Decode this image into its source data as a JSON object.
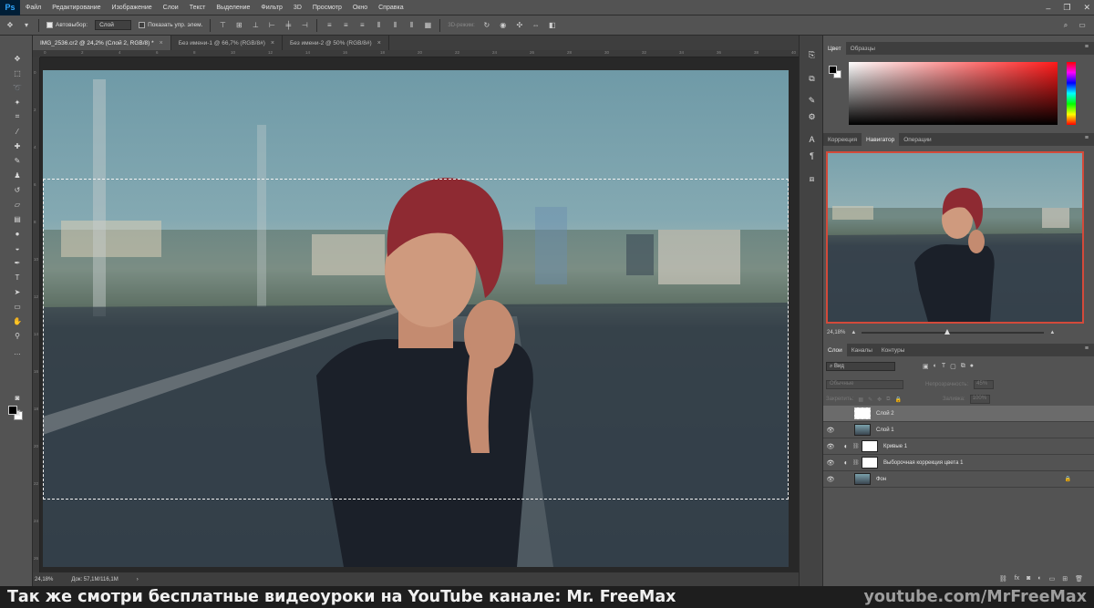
{
  "app": {
    "logo": "Ps"
  },
  "menu": [
    "Файл",
    "Редактирование",
    "Изображение",
    "Слои",
    "Текст",
    "Выделение",
    "Фильтр",
    "3D",
    "Просмотр",
    "Окно",
    "Справка"
  ],
  "options_bar": {
    "autoselect_label": "Автовыбор:",
    "autoselect_value": "Слой",
    "show_transform_label": "Показать упр. элем.",
    "mode_3d_label": "3D-режим:"
  },
  "document_tabs": [
    {
      "label": "IMG_2536.cr2 @ 24,2% (Слой 2, RGB/8) *",
      "active": true
    },
    {
      "label": "Без имени-1 @ 66,7% (RGB/8#)",
      "active": false
    },
    {
      "label": "Без имени-2 @ 50% (RGB/8#)",
      "active": false
    }
  ],
  "ruler_top_ticks": [
    "0",
    "2",
    "4",
    "6",
    "8",
    "10",
    "12",
    "14",
    "16",
    "18",
    "20",
    "22",
    "24",
    "26",
    "28",
    "30",
    "32",
    "34",
    "36",
    "38",
    "40"
  ],
  "ruler_left_ticks": [
    "0",
    "2",
    "4",
    "6",
    "8",
    "10",
    "12",
    "14",
    "16",
    "18",
    "20",
    "22",
    "24",
    "26"
  ],
  "status_bar": {
    "zoom": "24,18%",
    "doc_size": "Док: 57,1М/116,1М"
  },
  "color_panel": {
    "tabs": [
      "Цвет",
      "Образцы"
    ],
    "foreground_color": "#000000",
    "background_color": "#ffffff"
  },
  "navigator_panel": {
    "tabs": [
      "Коррекция",
      "Навигатор",
      "Операции"
    ],
    "active_tab": "Навигатор",
    "zoom": "24,18%",
    "zoom_slider_fraction": 0.47,
    "view_box_color": "#d34a3a"
  },
  "layers_panel": {
    "tabs": [
      "Слои",
      "Каналы",
      "Контуры"
    ],
    "kind_filter": "Вид",
    "blend_mode": "Обычные",
    "opacity_label": "Непрозрачность:",
    "opacity_value": "45%",
    "lock_label": "Закрепить:",
    "fill_label": "Заливка:",
    "fill_value": "100%",
    "layers": [
      {
        "name": "Слой 2",
        "type": "pixel",
        "selected": true,
        "visible": false,
        "locked": false
      },
      {
        "name": "Слой 1",
        "type": "pixel",
        "selected": false,
        "visible": true,
        "locked": false
      },
      {
        "name": "Кривые 1",
        "type": "adjustment",
        "selected": false,
        "visible": true,
        "locked": false
      },
      {
        "name": "Выборочная коррекция цвета 1",
        "type": "adjustment",
        "selected": false,
        "visible": true,
        "locked": false
      },
      {
        "name": "Фон",
        "type": "photo",
        "selected": false,
        "visible": true,
        "locked": true
      }
    ]
  },
  "caption": {
    "text": "Так же смотри бесплатные видеоуроки на YouTube канале: Mr. FreeMax",
    "url": "youtube.com/MrFreeMax"
  }
}
